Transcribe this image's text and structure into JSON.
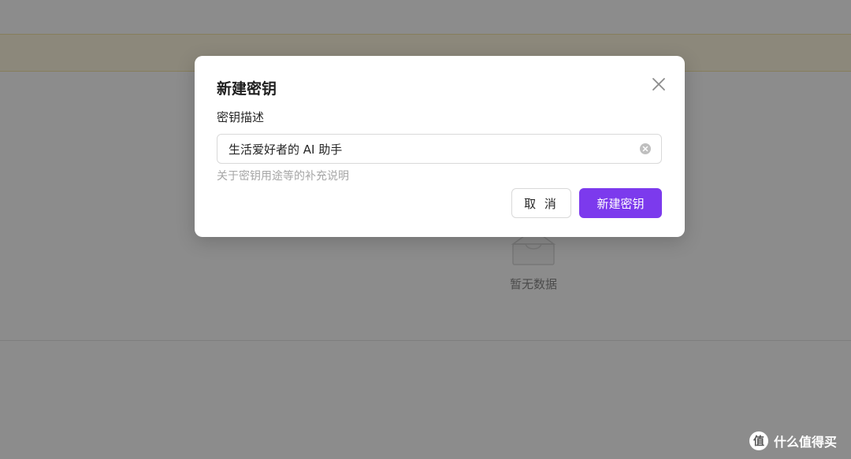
{
  "background": {
    "empty_state": {
      "icon": "empty-box-icon",
      "text": "暂无数据"
    }
  },
  "dialog": {
    "title": "新建密钥",
    "close_icon": "close-icon",
    "field": {
      "label": "密钥描述",
      "value": "生活爱好者的 AI 助手",
      "clear_icon": "clear-circle-icon",
      "hint": "关于密钥用途等的补充说明"
    },
    "buttons": {
      "cancel": "取 消",
      "confirm": "新建密钥"
    }
  },
  "watermark": {
    "logo": "zhi-logo-icon",
    "glyph": "值",
    "text": "什么值得买"
  },
  "colors": {
    "primary": "#7c3aed",
    "notice_bg": "#fff8e1",
    "mask": "rgba(0,0,0,0.45)"
  }
}
